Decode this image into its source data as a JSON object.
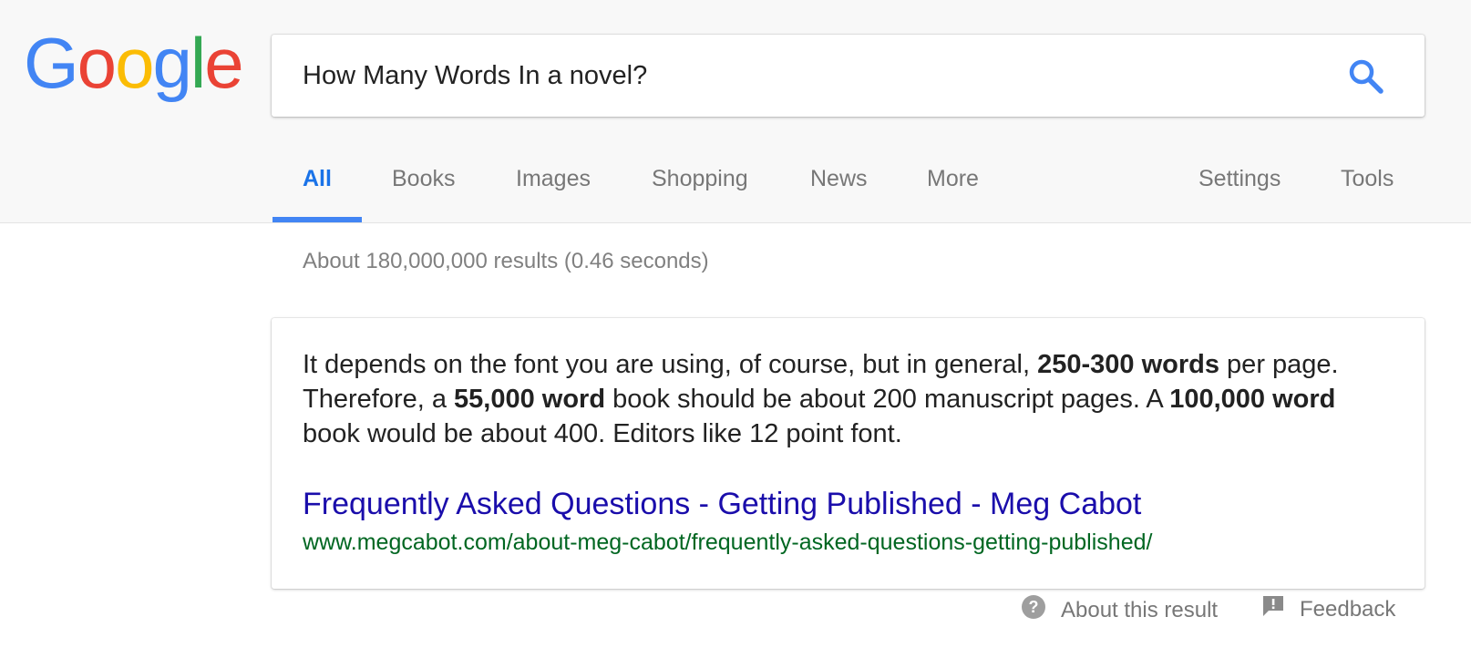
{
  "logo": {
    "letters": [
      "G",
      "o",
      "o",
      "g",
      "l",
      "e"
    ],
    "colors": [
      "#4285f4",
      "#ea4335",
      "#fbbc05",
      "#4285f4",
      "#34a853",
      "#ea4335"
    ]
  },
  "search": {
    "value": "How Many Words In a novel?",
    "icon": "search-icon"
  },
  "tabs": [
    {
      "label": "All",
      "active": true
    },
    {
      "label": "Books"
    },
    {
      "label": "Images"
    },
    {
      "label": "Shopping"
    },
    {
      "label": "News"
    },
    {
      "label": "More"
    },
    {
      "label": "Settings"
    },
    {
      "label": "Tools"
    }
  ],
  "result_stats": "About 180,000,000 results (0.46 seconds)",
  "featured_snippet": {
    "text_1": "It depends on the font you are using, of course, but in general, ",
    "bold_1": "250-300 words",
    "text_2": " per page. Therefore, a ",
    "bold_2": "55,000 word",
    "text_3": " book should be about 200 manuscript pages. A ",
    "bold_3": "100,000 word",
    "text_4": " book would be about 400. Editors like 12 point font.",
    "title": "Frequently Asked Questions - Getting Published - Meg Cabot",
    "url": "www.megcabot.com/about-meg-cabot/frequently-asked-questions-getting-published/"
  },
  "footer": {
    "about_label": "About this result",
    "about_icon": "help-circle-icon",
    "feedback_label": "Feedback",
    "feedback_icon": "feedback-icon"
  },
  "colors": {
    "accent": "#4285f4",
    "link": "#1a0dab",
    "url": "#006621",
    "muted": "#777777"
  }
}
